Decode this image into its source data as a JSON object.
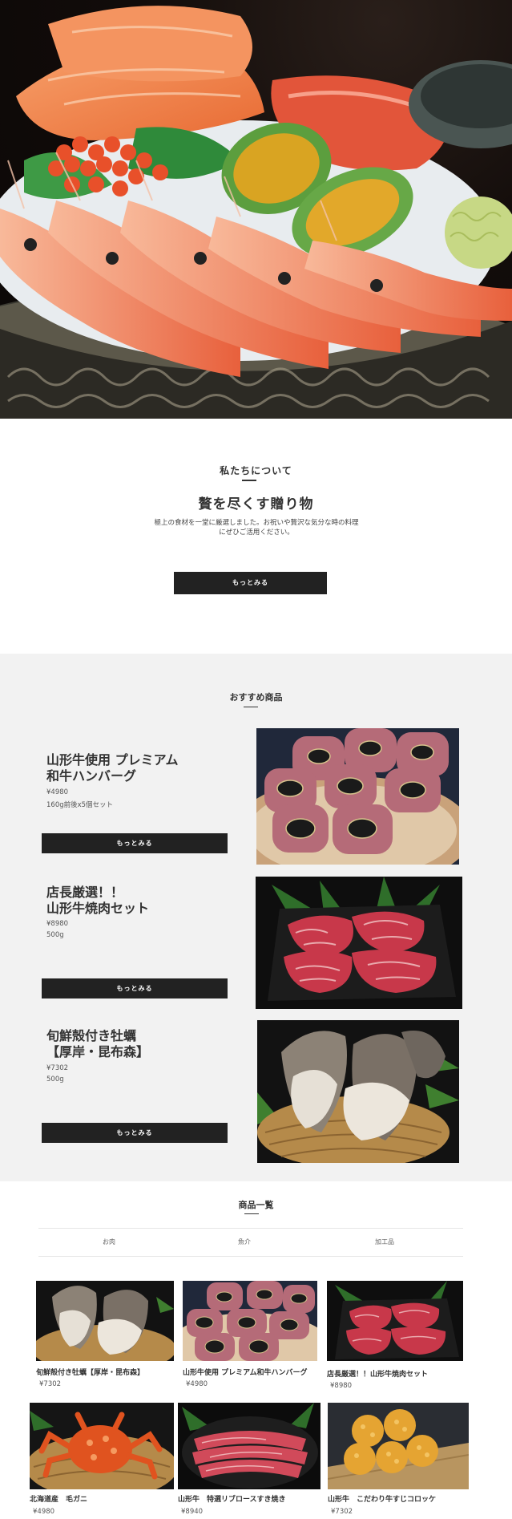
{
  "hero": {
    "image": "sashimi-platter-image"
  },
  "about": {
    "eyebrow": "私たちについて",
    "headline": "贅を尽くす贈り物",
    "description": "極上の食材を一堂に厳選しました。お祝いや贅沢な気分な時の料理にぜひご活用ください。",
    "button": "もっとみる"
  },
  "featured": {
    "title": "おすすめ商品",
    "items": [
      {
        "name": "山形牛使用 プレミアム\n和牛ハンバーグ",
        "price": "¥4980",
        "note": "160g前後x5個セット",
        "button": "もっとみる",
        "image": "hamburg-steak-image"
      },
      {
        "name": "店長厳選！！\n山形牛焼肉セット",
        "price": "¥8980",
        "note": "500g",
        "button": "もっとみる",
        "image": "yakiniku-beef-image"
      },
      {
        "name": "旬鮮殻付き牡蠣\n【厚岸・昆布森】",
        "price": "¥7302",
        "note": "500g",
        "button": "もっとみる",
        "image": "oysters-image"
      }
    ]
  },
  "product_list": {
    "title": "商品一覧",
    "tabs": [
      "お肉",
      "魚介",
      "加工品"
    ],
    "items": [
      {
        "name": "旬鮮殻付き牡蠣【厚岸・昆布森】",
        "price": "¥7302",
        "image": "oysters-image"
      },
      {
        "name": "山形牛使用 プレミアム和牛ハンバーグ",
        "price": "¥4980",
        "image": "hamburg-steak-image"
      },
      {
        "name": "店長厳選！！山形牛焼肉セット",
        "price": "¥8980",
        "image": "yakiniku-beef-image"
      },
      {
        "name": "北海道産　毛ガニ",
        "price": "¥4980",
        "image": "hairy-crab-image"
      },
      {
        "name": "山形牛　特選リブロースすき焼き",
        "price": "¥8940",
        "image": "sukiyaki-beef-image"
      },
      {
        "name": "山形牛　こだわり牛すじコロッケ",
        "price": "¥7302",
        "image": "croquette-image"
      }
    ]
  },
  "colors": {
    "button": "#222222",
    "featured_bg": "#f2f2f2",
    "text": "#333333"
  }
}
